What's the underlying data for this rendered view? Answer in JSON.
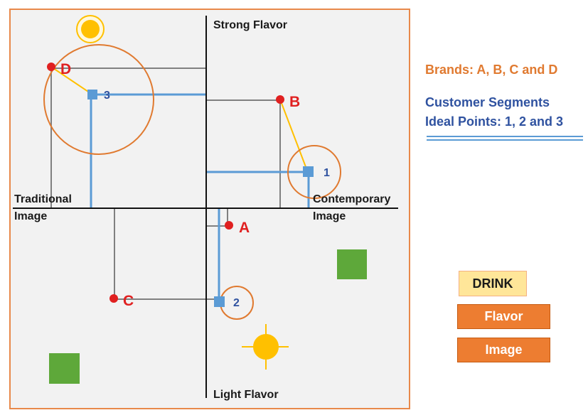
{
  "axes": {
    "vertical_top": "Strong Flavor",
    "vertical_bottom": "Light Flavor",
    "horizontal_left": [
      "Traditional",
      "Image"
    ],
    "horizontal_right": [
      "Contemporary",
      "Image"
    ]
  },
  "brands": [
    {
      "id": "A",
      "label": "A"
    },
    {
      "id": "B",
      "label": "B"
    },
    {
      "id": "C",
      "label": "C"
    },
    {
      "id": "D",
      "label": "D"
    }
  ],
  "ideal_points": [
    {
      "id": "1",
      "label": "1"
    },
    {
      "id": "2",
      "label": "2"
    },
    {
      "id": "3",
      "label": "3"
    }
  ],
  "legend": {
    "brands_text": "Brands:  A, B, C and D",
    "segments_line1": "Customer Segments",
    "segments_line2": "Ideal Points: 1, 2 and 3"
  },
  "buttons": {
    "drink": "DRINK",
    "flavor": "Flavor",
    "image": "Image"
  },
  "colors": {
    "frame": "#e8894a",
    "brand_point": "#e02020",
    "brand_label": "#e02020",
    "ideal_point": "#5b9bd5",
    "ideal_label": "#2f52a0",
    "brand_legend": "#e07a30",
    "segment_legend": "#2f52a0",
    "gray_line": "#808080",
    "blue_line": "#5b9bd5",
    "link_line": "#ffc000",
    "circle": "#e07a30",
    "sun": "#ffc000",
    "green_square": "#5ea83a",
    "drink_bg": "#ffe699",
    "orange_button": "#ed7d31"
  }
}
